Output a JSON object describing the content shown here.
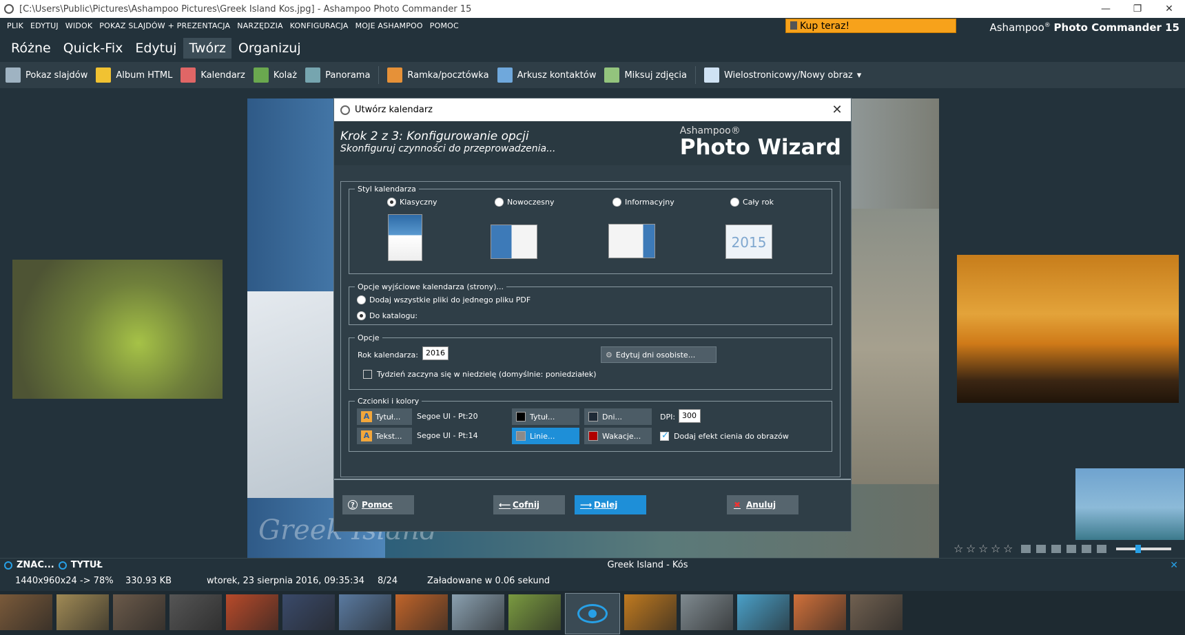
{
  "window": {
    "title": "[C:\\Users\\Public\\Pictures\\Ashampoo Pictures\\Greek Island Kos.jpg] - Ashampoo Photo Commander 15",
    "minimize": "—",
    "restore": "❐",
    "close": "✕"
  },
  "menu": [
    "PLIK",
    "EDYTUJ",
    "WIDOK",
    "POKAZ SLAJDÓW + PREZENTACJA",
    "NARZĘDZIA",
    "KONFIGURACJA",
    "MOJE ASHAMPOO",
    "POMOC"
  ],
  "buy_label": "Kup teraz!",
  "brand": {
    "name": "Ashampoo",
    "reg": "®",
    "product": "Photo Commander 15"
  },
  "tabs": [
    "Różne",
    "Quick-Fix",
    "Edytuj",
    "Twórz",
    "Organizuj"
  ],
  "toolbar": [
    {
      "label": "Pokaz slajdów",
      "color": "#9fb3c2"
    },
    {
      "label": "Album HTML",
      "color": "#f1c232"
    },
    {
      "label": "Kalendarz",
      "color": "#e06666"
    },
    {
      "label": "Kolaż",
      "color": "#6aa84f"
    },
    {
      "label": "Panorama",
      "color": "#76a5af"
    },
    {
      "label": "Ramka/pocztówka",
      "color": "#e69138"
    },
    {
      "label": "Arkusz kontaktów",
      "color": "#6fa8dc"
    },
    {
      "label": "Miksuj zdjęcia",
      "color": "#93c47d"
    },
    {
      "label": "Wielostronicowy/Nowy obraz",
      "color": "#cfe2f3"
    }
  ],
  "toolbar_dropdown": "▾",
  "viewer": {
    "watermark": "Greek Island"
  },
  "dialog": {
    "title": "Utwórz kalendarz",
    "close": "✕",
    "step": "Krok 2 z 3: Konfigurowanie opcji",
    "step_sub": "Skonfiguruj czynności do przeprowadzenia...",
    "wizard_brand": "Ashampoo®",
    "wizard_name": "Photo Wizard",
    "style_group": "Styl kalendarza",
    "styles": [
      "Klasyczny",
      "Nowoczesny",
      "Informacyjny",
      "Cały rok"
    ],
    "style_year_preview": "2015",
    "output_group": "Opcje wyjściowe kalendarza (strony)...",
    "output_pdf": "Dodaj wszystkie pliki do jednego pliku PDF",
    "output_dir": "Do katalogu:",
    "options_group": "Opcje",
    "year_label": "Rok kalendarza:",
    "year_value": "2016",
    "edit_days": "Edytuj dni osobiste...",
    "week_sunday": "Tydzień zaczyna się w niedzielę (domyślnie: poniedziałek)",
    "fonts_group": "Czcionki i kolory",
    "title_font_btn": "Tytuł...",
    "title_font": "Segoe UI - Pt:20",
    "text_font_btn": "Tekst...",
    "text_font": "Segoe UI - Pt:14",
    "color_title": "Tytuł...",
    "color_days": "Dni...",
    "color_lines": "Linie...",
    "color_holidays": "Wakacje...",
    "dpi_label": "DPI:",
    "dpi_value": "300",
    "shadow": "Dodaj efekt cienia do obrazów",
    "btn_help": "Pomoc",
    "btn_back": "Cofnij",
    "btn_next": "Dalej",
    "btn_cancel": "Anuluj"
  },
  "info": {
    "tag_label": "ZNAC...",
    "title_label": "TYTUŁ",
    "image_title": "Greek Island - Kós",
    "close": "✕",
    "dimensions": "1440x960x24 -> 78%",
    "filesize": "330.93 KB",
    "date": "wtorek, 23 sierpnia 2016, 09:35:34",
    "position": "8/24",
    "loaded": "Załadowane w 0.06 sekund"
  },
  "colors": {
    "accent": "#27a0e6",
    "bg": "#23323b",
    "buy": "#f7a21b"
  },
  "thumbs": [
    "#7a5a3a",
    "#a08a55",
    "#6b5a4a",
    "#555555",
    "#b84a2a",
    "#3a4a6a",
    "#5a7aa0",
    "#c0642a",
    "#8aa0b0",
    "#7a9a40",
    "#3a4a54",
    "#c07a20",
    "#7f8a90",
    "#4aa0c8",
    "#d0703a",
    "#706050"
  ]
}
